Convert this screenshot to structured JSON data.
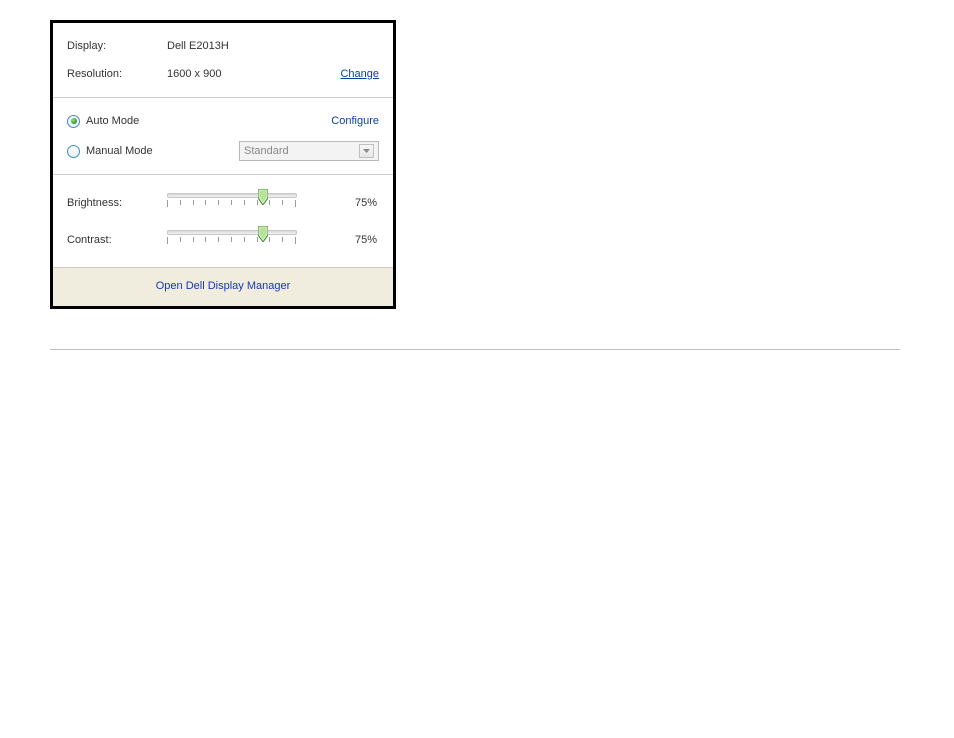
{
  "info": {
    "display_label": "Display:",
    "display_value": "Dell E2013H",
    "resolution_label": "Resolution:",
    "resolution_value": "1600 x 900",
    "change_link": "Change"
  },
  "mode": {
    "auto_label": "Auto Mode",
    "manual_label": "Manual Mode",
    "configure_link": "Configure",
    "preset_selected": "Standard"
  },
  "sliders": {
    "brightness_label": "Brightness:",
    "brightness_value": "75%",
    "brightness_percent": 75,
    "contrast_label": "Contrast:",
    "contrast_value": "75%",
    "contrast_percent": 75
  },
  "footer": {
    "open_label": "Open Dell Display Manager"
  }
}
